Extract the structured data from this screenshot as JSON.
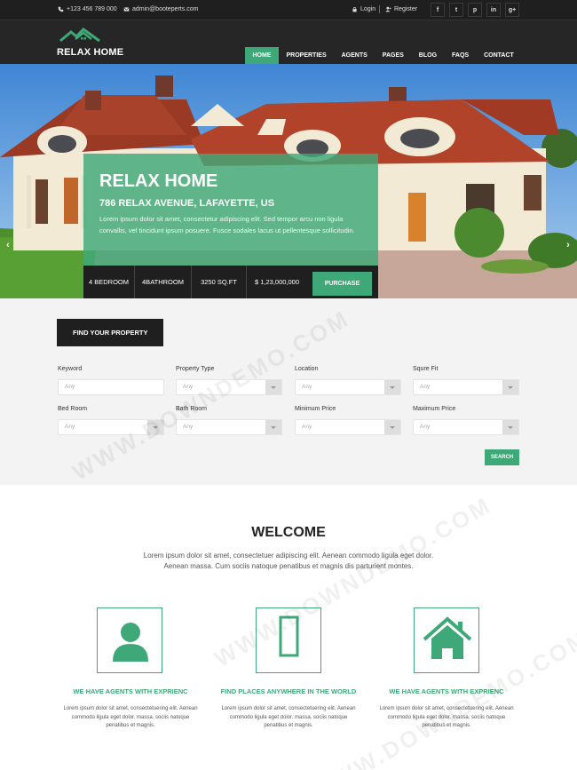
{
  "topbar": {
    "phone": "+123 456 789 000",
    "email": "admin@booteperts.com",
    "login": "Login",
    "register": "Register",
    "socials": [
      {
        "icon": "facebook-icon",
        "glyph": "f"
      },
      {
        "icon": "twitter-icon",
        "glyph": "t"
      },
      {
        "icon": "pinterest-icon",
        "glyph": "p"
      },
      {
        "icon": "linkedin-icon",
        "glyph": "in"
      },
      {
        "icon": "google-plus-icon",
        "glyph": "g+"
      }
    ]
  },
  "header": {
    "logo_text": "RELAX HOME",
    "nav": [
      "HOME",
      "PROPERTIES",
      "AGENTS",
      "PAGES",
      "BLOG",
      "FAQS",
      "CONTACT"
    ],
    "active_nav": "HOME"
  },
  "hero": {
    "title": "RELAX HOME",
    "address": "786 RELAX AVENUE, LAFAYETTE, US",
    "description": "Lorem ipsum dolor sit amet, consectetur adipiscing elit. Sed tempor arcu non ligula convallis, vel tincidunt ipsum posuere. Fusce sodales lacus ut pellentesque sollicitudin.",
    "stats": {
      "bedroom": "4 BEDROOM",
      "bathroom": "4BATHROOM",
      "area": "3250 SQ.FT",
      "price": "$ 1,23,000,000"
    },
    "purchase_label": "PURCHASE"
  },
  "search": {
    "find_label": "FIND YOUR PROPERTY",
    "fields": {
      "keyword": {
        "label": "Keyword",
        "value": "Any"
      },
      "property_type": {
        "label": "Property Type",
        "value": "Any"
      },
      "location": {
        "label": "Location",
        "value": "Any"
      },
      "squre_fit": {
        "label": "Squre Fit",
        "value": "Any"
      },
      "bed_room": {
        "label": "Bed Room",
        "value": "Any"
      },
      "bath_room": {
        "label": "Bath Room",
        "value": "Any"
      },
      "minimum_price": {
        "label": "Minimum Price",
        "value": "Any"
      },
      "maximum_price": {
        "label": "Maximum Price",
        "value": "Any"
      }
    },
    "search_label": "SEARCH"
  },
  "welcome": {
    "title": "WELCOME",
    "text": "Lorem ipsum dolor sit amet, consectetuer adipiscing elit. Aenean commodo ligula eget dolor. Aenean massa. Cum sociis natoque penatibus et magnis dis parturient montes."
  },
  "features": [
    {
      "icon": "user-icon",
      "title": "WE HAVE AGENTS WITH EXPRIENC",
      "text": "Lorem ipsum dolor sit amet, consectetuering elit. Aenean commodo ligula eget dolor. massa. sociis natoque penatibus et magnis."
    },
    {
      "icon": "mobile-icon",
      "title": "FIND PLACES ANYWHERE IN THE WORLD",
      "text": "Lorem ipsum dolor sit amet, consectetuering elit. Aenean commodo ligula eget dolor. massa. sociis natoque penatibus et magnis."
    },
    {
      "icon": "home-icon",
      "title": "WE HAVE AGENTS WITH EXPRIENC",
      "text": "Lorem ipsum dolor sit amet, consectetuering elit. Aenean commodo ligula eget dolor. massa. sociis natoque penatibus et magnis."
    }
  ],
  "watermark": "WWW.DOWNDEMO.COM",
  "colors": {
    "accent": "#3fa878",
    "dark": "#1f1f1f",
    "header": "#262626"
  }
}
